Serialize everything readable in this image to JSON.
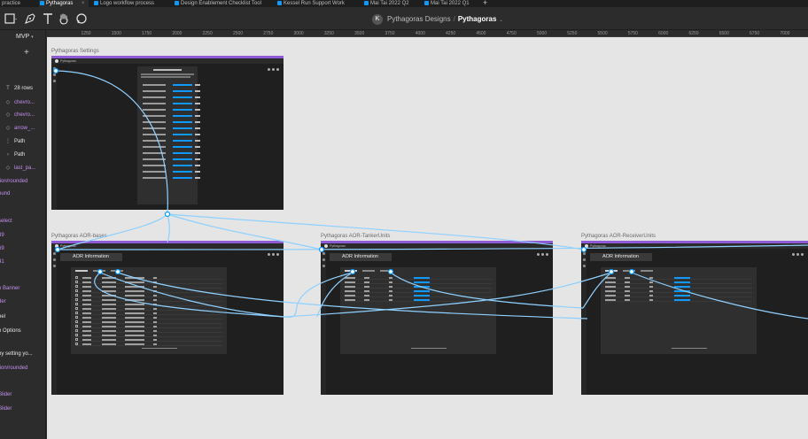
{
  "tabs": [
    {
      "label": "practice",
      "active": false
    },
    {
      "label": "Pythagoras",
      "active": true
    },
    {
      "label": "Logo workflow process",
      "active": false
    },
    {
      "label": "Design Enablement Checklist Tool",
      "active": false
    },
    {
      "label": "Kessel Run Support Work",
      "active": false
    },
    {
      "label": "Mai Tai 2022 Q2",
      "active": false
    },
    {
      "label": "Mai Tai 2022 Q1",
      "active": false
    }
  ],
  "toolbar": {
    "tool_icons": [
      "frame-icon",
      "pen-icon",
      "text-icon",
      "hand-icon",
      "comment-icon"
    ],
    "project_avatar": "K",
    "project_team": "Pythagoras Designs",
    "project_separator": "/",
    "project_file": "Pythagoras"
  },
  "left_panel": {
    "page_name": "MVP",
    "add_symbol": "+",
    "layers": [
      {
        "icon": "T",
        "label": "28 rows",
        "purple": false
      },
      {
        "icon": "◇",
        "label": "chevro...",
        "purple": true
      },
      {
        "icon": "◇",
        "label": "chevro...",
        "purple": true
      },
      {
        "icon": "◇",
        "label": "arrow_...",
        "purple": true
      },
      {
        "icon": "⋮",
        "label": "Path",
        "purple": false
      },
      {
        "icon": "›",
        "label": "Path",
        "purple": false
      },
      {
        "icon": "◇",
        "label": "last_pa...",
        "purple": true
      },
      {
        "icon": "",
        "label": "tion/rounded",
        "purple": true
      },
      {
        "icon": "",
        "label": "ound",
        "purple": true
      },
      {
        "icon": "",
        "label": "select",
        "purple": true
      },
      {
        "icon": "",
        "label": "39",
        "purple": true
      },
      {
        "icon": "",
        "label": "69",
        "purple": true
      },
      {
        "icon": "",
        "label": "41",
        "purple": true
      },
      {
        "icon": "",
        "label": "n Banner",
        "purple": true
      },
      {
        "icon": "",
        "label": "der",
        "purple": true
      },
      {
        "icon": "",
        "label": "nel",
        "purple": false
      },
      {
        "icon": "",
        "label": "n Options",
        "purple": false
      },
      {
        "icon": "",
        "label": "by setting yo...",
        "purple": false
      },
      {
        "icon": "",
        "label": "tion/rounded",
        "purple": true
      },
      {
        "icon": "",
        "label": "Slider",
        "purple": true
      },
      {
        "icon": "",
        "label": "Slider",
        "purple": true
      }
    ]
  },
  "ruler_top": [
    "1250",
    "1500",
    "1750",
    "2000",
    "2250",
    "2500",
    "2750",
    "3000",
    "3250",
    "3500",
    "3750",
    "4000",
    "4250",
    "4500",
    "4750",
    "5000",
    "5250",
    "5500",
    "5750",
    "6000",
    "6250",
    "6500",
    "6750",
    "7000",
    "7250"
  ],
  "ruler_left": [
    "3000",
    "3250",
    "3500",
    "3750",
    "4000",
    "4250",
    "4500",
    "4750",
    "5000",
    "5250",
    "5500"
  ],
  "frames": {
    "settings": {
      "label": "Pythagoras Settings",
      "app_name": "Pythagoras"
    },
    "aor_bases": {
      "label": "Pythagoras AOR-bases",
      "title": "AOR Information",
      "app_name": "Pythagoras"
    },
    "aor_tanker": {
      "label": "Pythagoras AOR-TankerUnits",
      "title": "AOR Information",
      "app_name": "Pythagoras"
    },
    "aor_receiver": {
      "label": "Pythagoras AOR-ReceiverUnits",
      "title": "AOR Information",
      "app_name": "Pythagoras"
    }
  },
  "colors": {
    "canvas": "#e5e5e5",
    "connector": "#8fd0ff",
    "frame_accent": "#8e5bd6",
    "node": "#0d99ff"
  }
}
